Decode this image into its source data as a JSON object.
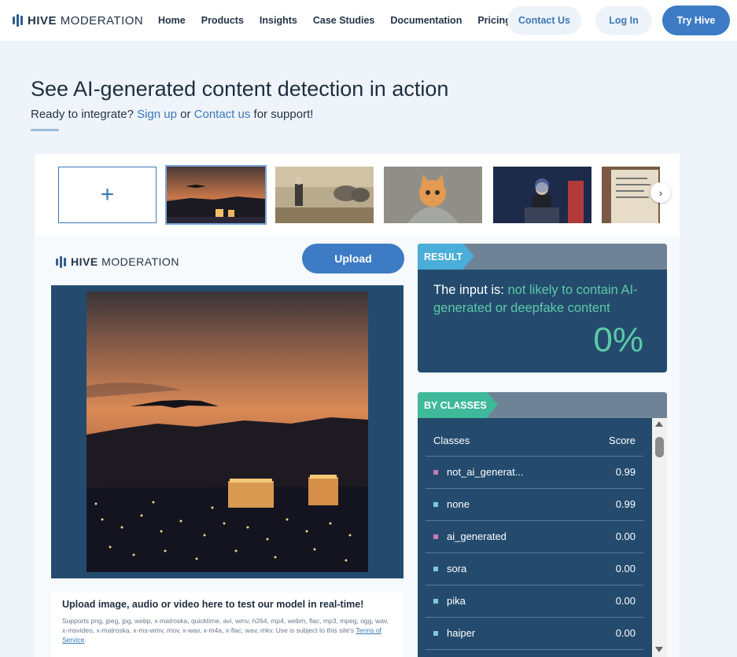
{
  "nav": {
    "logo_bold": "HIVE",
    "logo_light": "MODERATION",
    "links": [
      "Home",
      "Products",
      "Insights",
      "Case Studies",
      "Documentation",
      "Pricing"
    ],
    "contact_label": "Contact Us",
    "login_label": "Log In",
    "try_label": "Try Hive"
  },
  "hero": {
    "title": "See AI-generated content detection in action",
    "sub_prefix": "Ready to integrate? ",
    "signup_link": "Sign up",
    "sub_middle": " or ",
    "contact_link": "Contact us",
    "sub_suffix": " for support!"
  },
  "thumbnails": {
    "add_symbol": "+",
    "next_symbol": "›",
    "items": [
      "stealth-bomber-night-city",
      "painting-elephants-figures",
      "cat-in-hoodie",
      "speaker-at-podium",
      "old-document"
    ]
  },
  "demo": {
    "logo_bold": "HIVE",
    "logo_light": "MODERATION",
    "upload_label": "Upload",
    "upload_title": "Upload image, audio or video here to test our model in real-time!",
    "upload_desc": "Supports png, jpeg, jpg, webp, x-matroska, quicktime, avi, wmv, h264, mp4, webm, flac, mp3, mpeg, ogg, wav, x-msvideo, x-matroska, x-ms-wmv, mov, x-wav, x-m4a, x-flac, wav, mkv. Use is subject to this site's ",
    "terms_link": "Terms of Service",
    "terms_suffix": "."
  },
  "result": {
    "tag": "RESULT",
    "prefix": "The input is: ",
    "verdict": "not likely to contain AI-generated or deepfake content",
    "percent": "0%"
  },
  "classes": {
    "tag": "BY CLASSES",
    "col_class": "Classes",
    "col_score": "Score",
    "rows": [
      {
        "name": "not_ai_generat...",
        "score": "0.99",
        "color": "#c879b8"
      },
      {
        "name": "none",
        "score": "0.99",
        "color": "#7ecad9"
      },
      {
        "name": "ai_generated",
        "score": "0.00",
        "color": "#c879b8"
      },
      {
        "name": "sora",
        "score": "0.00",
        "color": "#7ecad9"
      },
      {
        "name": "pika",
        "score": "0.00",
        "color": "#7ecad9"
      },
      {
        "name": "haiper",
        "score": "0.00",
        "color": "#7ecad9"
      }
    ]
  },
  "colors": {
    "accent": "#3d7cc4",
    "dark_panel": "#244b6e",
    "result_tag": "#4aaed8",
    "classes_tag": "#3fb99a",
    "highlight": "#5cc9a7"
  }
}
